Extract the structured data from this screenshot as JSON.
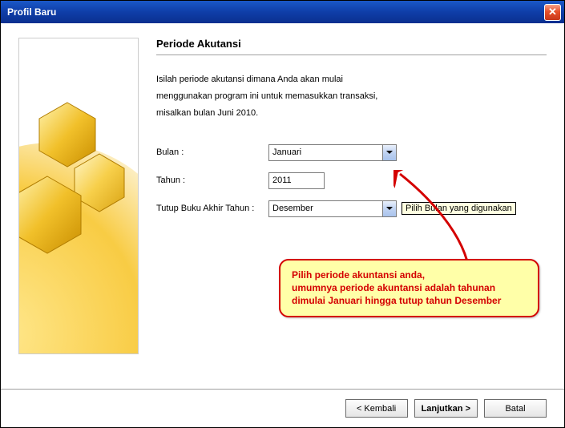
{
  "window": {
    "title": "Profil Baru"
  },
  "heading": "Periode Akutansi",
  "intro_lines": [
    "Isilah periode akutansi dimana Anda akan mulai",
    "menggunakan program ini untuk memasukkan transaksi,",
    "misalkan bulan Juni 2010."
  ],
  "form": {
    "bulan_label": "Bulan :",
    "bulan_value": "Januari",
    "tahun_label": "Tahun :",
    "tahun_value": "2011",
    "tutup_label": "Tutup Buku Akhir Tahun :",
    "tutup_value": "Desember"
  },
  "tooltip": "Pilih Bulan yang digunakan",
  "callout": [
    "Pilih periode akuntansi anda,",
    "umumnya periode akuntansi adalah tahunan",
    "dimulai Januari hingga tutup tahun Desember"
  ],
  "buttons": {
    "back": "< Kembali",
    "next": "Lanjutkan >",
    "cancel": "Batal"
  }
}
